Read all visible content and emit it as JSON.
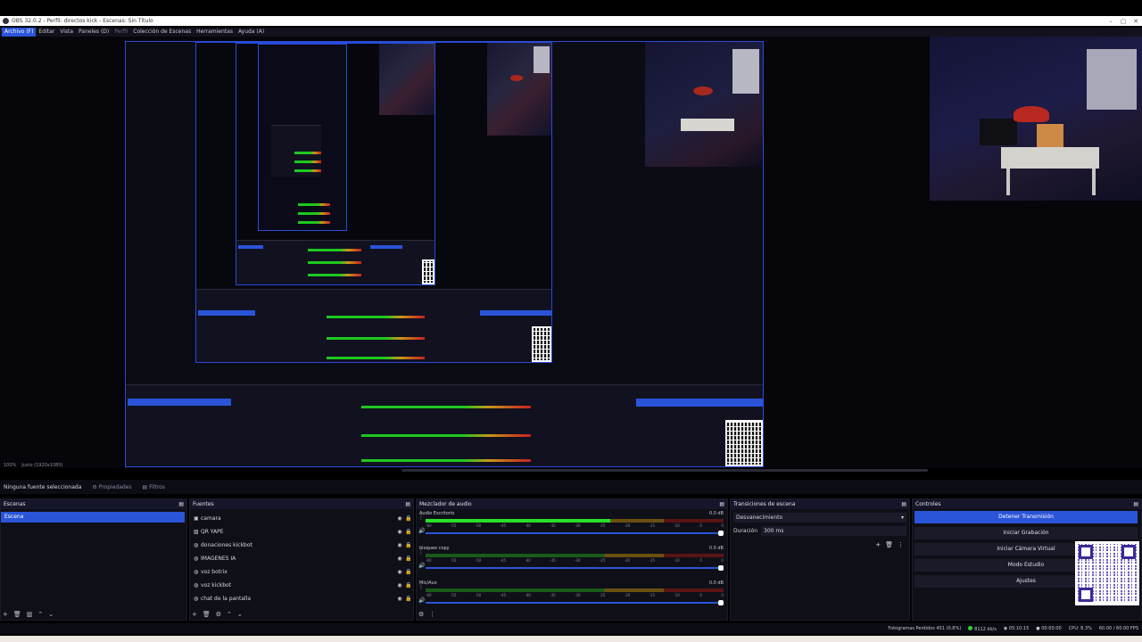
{
  "window": {
    "title": "OBS 32.0.2 - Perfil: directos kick - Escenas: Sin Título",
    "controls": [
      "–",
      "▢",
      "✕"
    ]
  },
  "menu": [
    "Archivo (F)",
    "Editar",
    "Vista",
    "Paneles (D)",
    "Perfil",
    "Colección de Escenas",
    "Herramientas",
    "Ayuda (A)"
  ],
  "canvas_status": {
    "zoom": "100%",
    "fit": "Justo (1920x1080)"
  },
  "context_bar": {
    "no_source": "Ninguna fuente seleccionada",
    "properties": "Propiedades",
    "filters": "Filtros"
  },
  "scenes": {
    "title": "Escenas",
    "items": [
      "Escena"
    ]
  },
  "sources": {
    "title": "Fuentes",
    "items": [
      {
        "icon": "camera-icon",
        "name": "camara"
      },
      {
        "icon": "image-icon",
        "name": "QR YAPE"
      },
      {
        "icon": "globe-icon",
        "name": "donaciones kickbot"
      },
      {
        "icon": "globe-icon",
        "name": "IMAGENES IA"
      },
      {
        "icon": "globe-icon",
        "name": "voz botrix"
      },
      {
        "icon": "globe-icon",
        "name": "voz kickbot"
      },
      {
        "icon": "globe-icon",
        "name": "chat de la pantalla"
      }
    ]
  },
  "mixer": {
    "title": "Mezclador de audio",
    "channels": [
      {
        "name": "Audio Escritorio",
        "db": "0.0 dB",
        "level": 0.62
      },
      {
        "name": "bloqueo copy",
        "db": "0.0 dB",
        "level": 0
      },
      {
        "name": "Mic/Aux",
        "db": "0.0 dB",
        "level": 0
      }
    ],
    "ticks": [
      "-60",
      "-55",
      "-50",
      "-45",
      "-40",
      "-35",
      "-30",
      "-25",
      "-20",
      "-15",
      "-10",
      "-5",
      "0"
    ]
  },
  "transitions": {
    "title": "Transiciones de escena",
    "selected": "Desvanecimiento",
    "duration_label": "Duración",
    "duration_value": "300 ms"
  },
  "controls": {
    "title": "Controles",
    "buttons": [
      "Detener Transmisión",
      "Iniciar Grabación",
      "Iniciar Cámara Virtual",
      "Modo Estudio",
      "Ajustes"
    ]
  },
  "status": {
    "dropped": "Fotogramas Perdidos 451 (0.8%)",
    "bitrate": "8112 kb/s",
    "stream_time": "05:10:15",
    "rec_time": "00:00:00",
    "cpu": "CPU: 8.3%",
    "fps": "60.00 / 60.00 FPS"
  },
  "colors": {
    "accent": "#2a55d8",
    "meter_green": "#28e028",
    "meter_yellow": "#c89818",
    "meter_red": "#c82020"
  }
}
